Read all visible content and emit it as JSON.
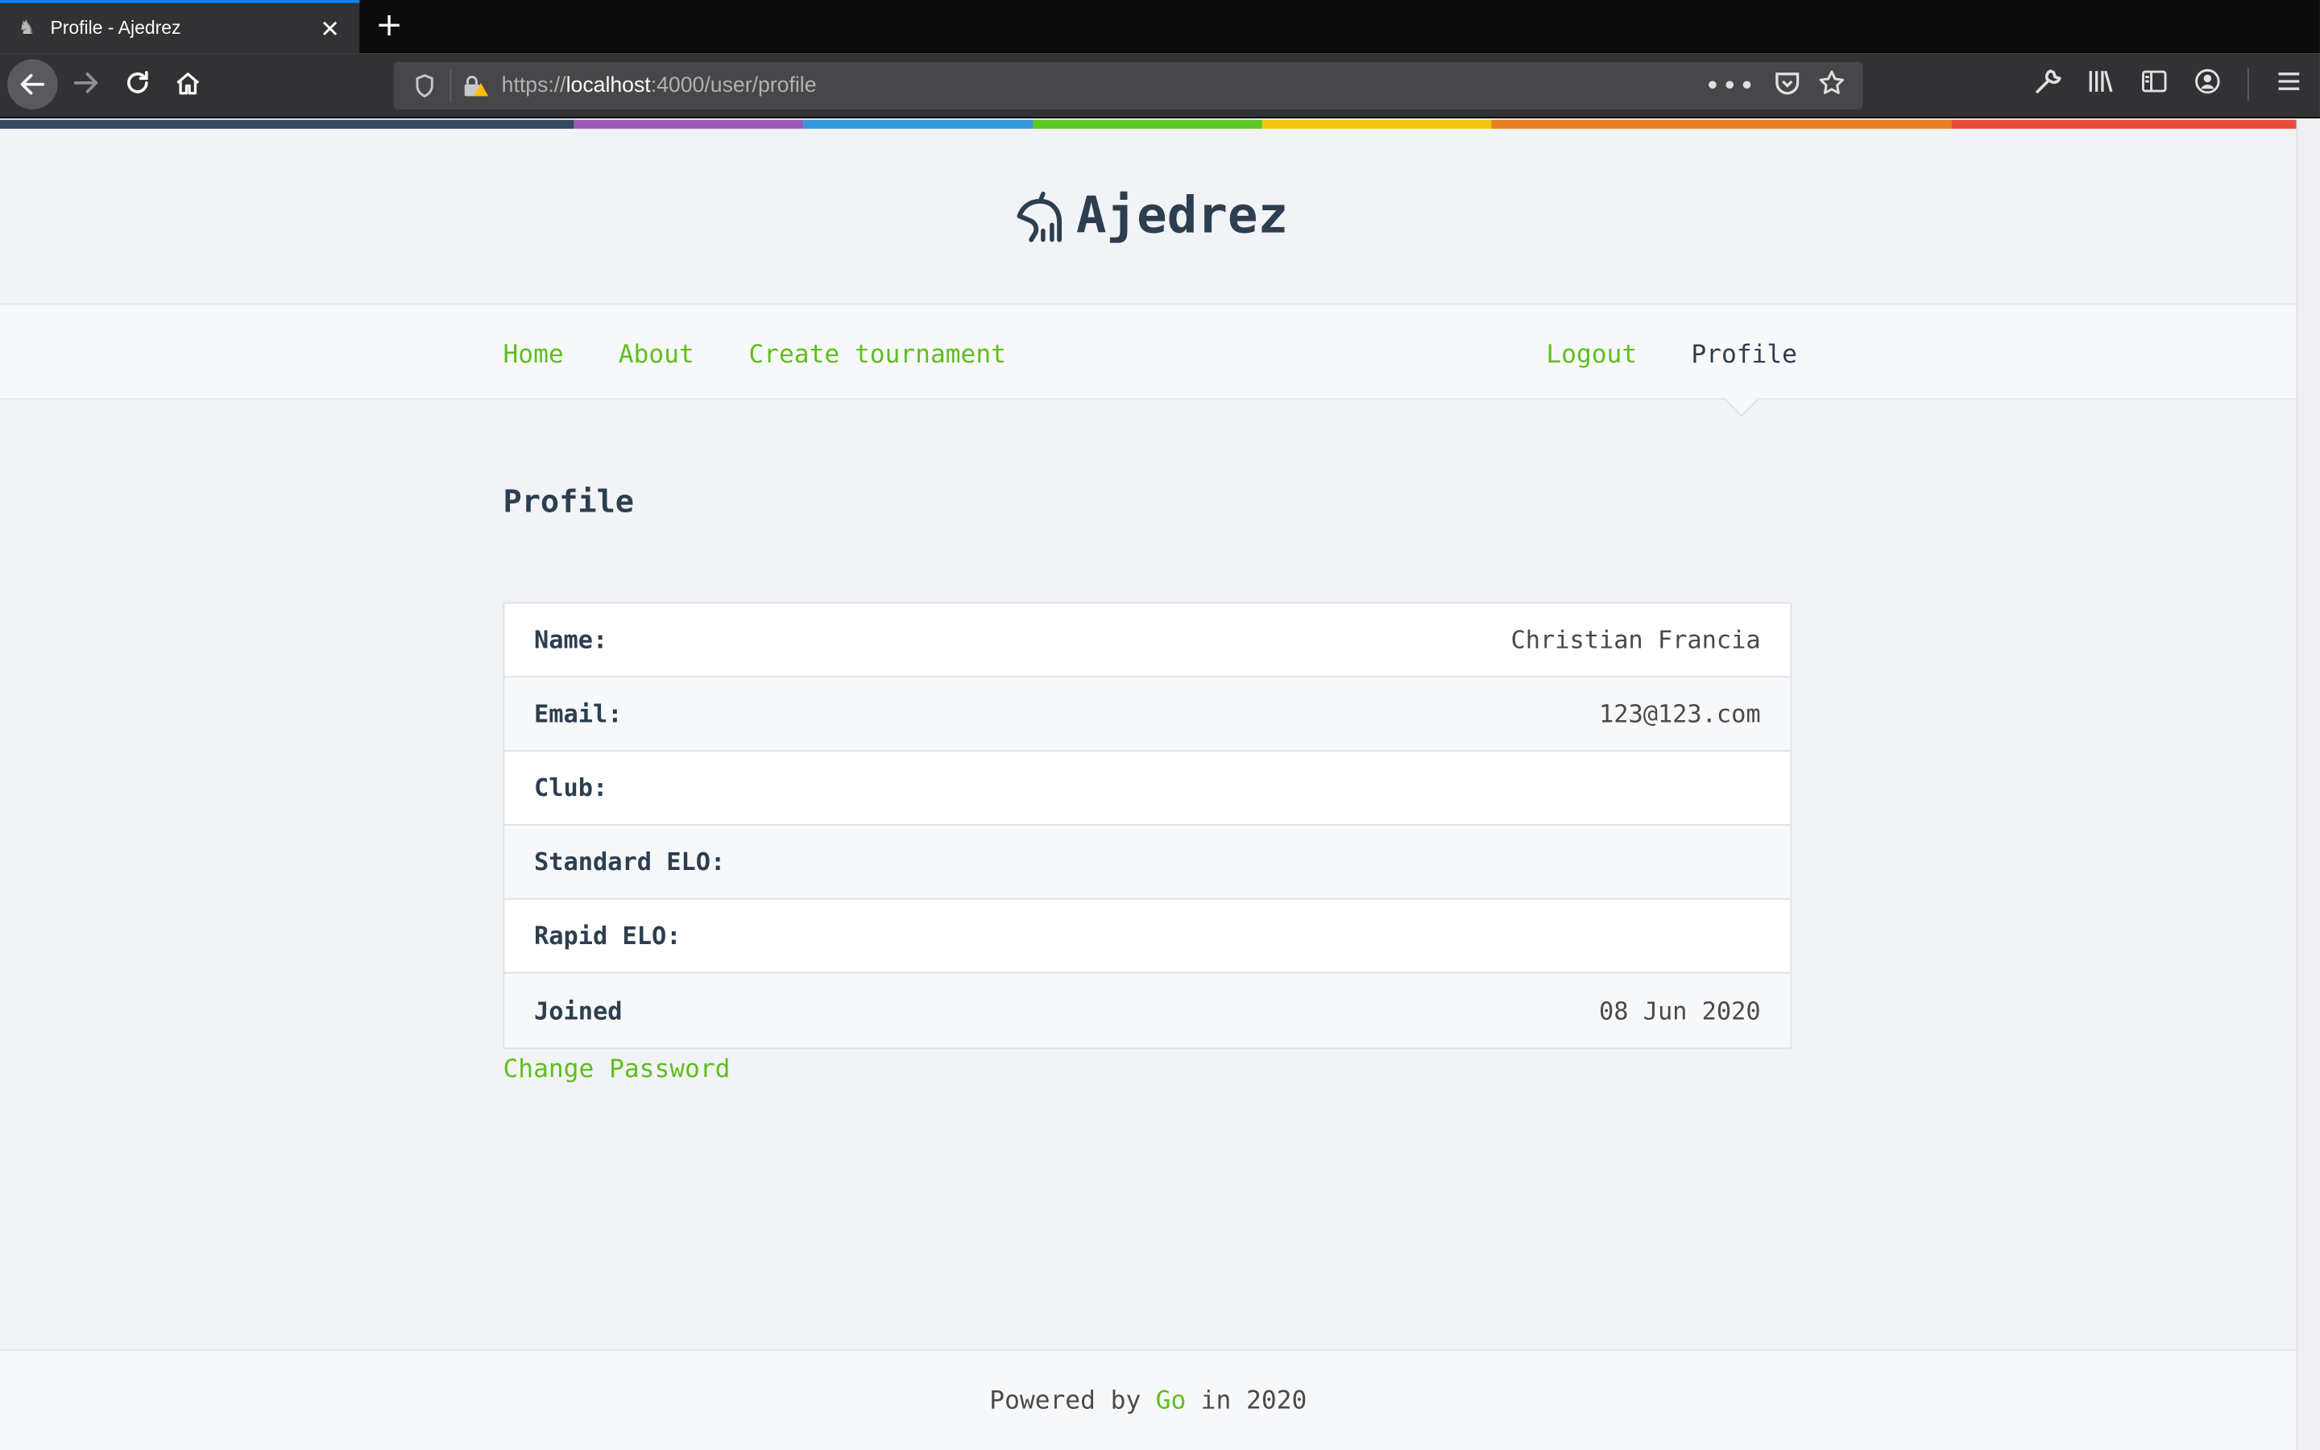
{
  "browser": {
    "tab_title": "Profile - Ajedrez",
    "url_scheme": "https://",
    "url_host": "localhost",
    "url_rest": ":4000/user/profile"
  },
  "colors": {
    "accent": "#5fbf20",
    "heading": "#2c3e50",
    "rainbow": [
      "#34495e",
      "#9b59b6",
      "#3498db",
      "#5bc726",
      "#f1c40f",
      "#e67e22",
      "#e74c3c"
    ]
  },
  "brand": {
    "name": "Ajedrez"
  },
  "nav": {
    "left": [
      {
        "label": "Home"
      },
      {
        "label": "About"
      },
      {
        "label": "Create tournament"
      }
    ],
    "right": [
      {
        "label": "Logout"
      },
      {
        "label": "Profile"
      }
    ]
  },
  "page": {
    "title": "Profile",
    "fields": [
      {
        "label": "Name:",
        "value": "Christian Francia"
      },
      {
        "label": "Email:",
        "value": "123@123.com"
      },
      {
        "label": "Club:",
        "value": ""
      },
      {
        "label": "Standard ELO:",
        "value": ""
      },
      {
        "label": "Rapid ELO:",
        "value": ""
      },
      {
        "label": "Joined",
        "value": "08 Jun 2020"
      }
    ],
    "change_password": "Change Password"
  },
  "footer": {
    "prefix": "Powered by",
    "link": "Go",
    "suffix": "in 2020"
  }
}
